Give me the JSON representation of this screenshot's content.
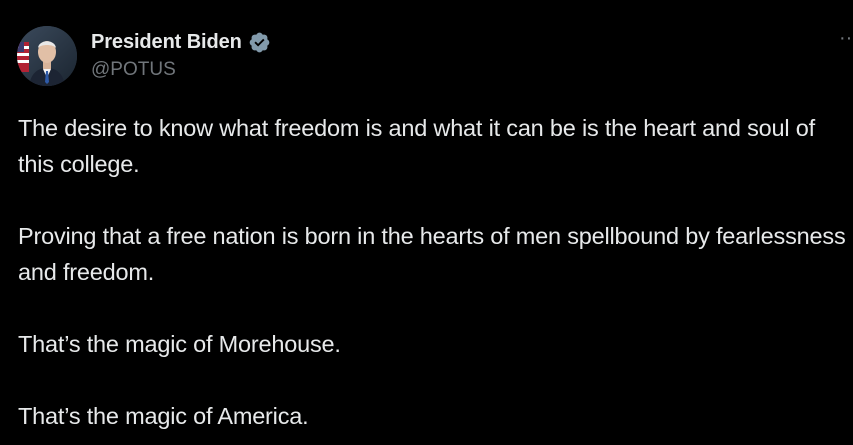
{
  "author": {
    "display_name": "President Biden",
    "handle": "@POTUS",
    "verified": true,
    "avatar_icon": "portrait-avatar",
    "verified_icon": "verified-badge-icon",
    "verified_color": "#829aab"
  },
  "tweet": {
    "paragraphs": [
      "The desire to know what freedom is and what it can be is the heart and soul of this college.",
      "Proving that a free nation is born in the hearts of men spellbound by fearlessness and freedom.",
      "That’s the magic of Morehouse.",
      "That’s the magic of America."
    ]
  },
  "more_menu": {
    "icon": "more-options-icon",
    "glyph": "··"
  },
  "colors": {
    "background": "#000000",
    "primary_text": "#e7e9ea",
    "secondary_text": "#71767b"
  }
}
